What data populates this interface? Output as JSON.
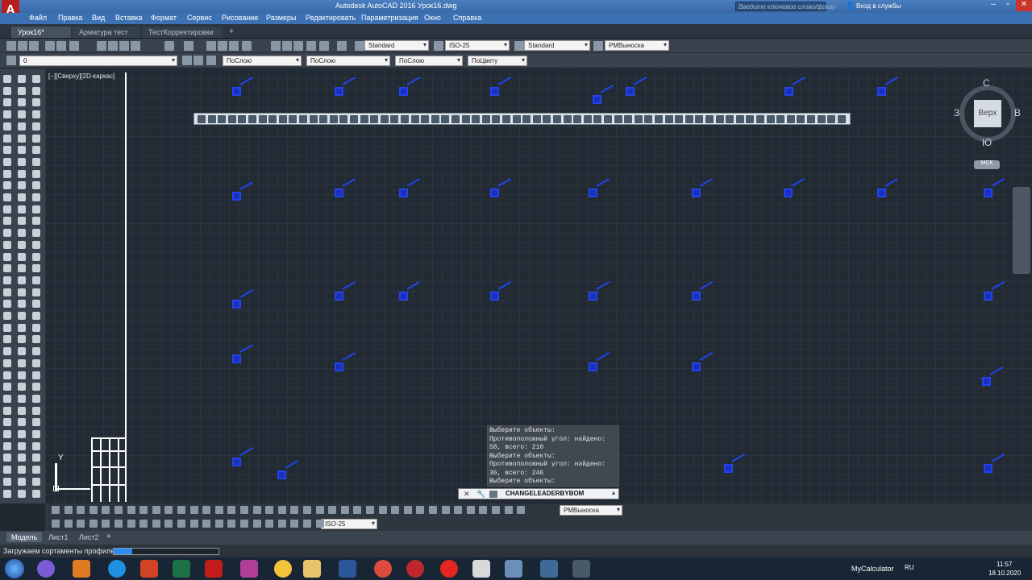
{
  "window": {
    "title": "Autodesk AutoCAD 2016   Урок16.dwg",
    "search_placeholder": "Введите ключевое слово/фразу",
    "sign_in": "Вход в службы"
  },
  "menu": [
    "Файл",
    "Правка",
    "Вид",
    "Вставка",
    "Формат",
    "Сервис",
    "Рисование",
    "Размеры",
    "Редактировать",
    "Параметризация",
    "Окно",
    "Справка"
  ],
  "tabs": [
    "Урок16*",
    "Арматура тест",
    "ТестКорректировки"
  ],
  "toolbar1": {
    "text_style": "Standard",
    "dim_style": "ISO-25",
    "table_style": "Standard",
    "mleader_style": "РМВыноска"
  },
  "toolbar2": {
    "layer": "0",
    "color": "ПоСлою",
    "linetype": "ПоСлою",
    "lineweight": "ПоСлою",
    "plotstyle": "ПоЦвету"
  },
  "viewport": {
    "label": "[−][Сверху][2D-каркас]"
  },
  "viewcube": {
    "north": "С",
    "south": "Ю",
    "west": "З",
    "east": "В",
    "face": "Верх",
    "ucs": "МСК"
  },
  "ucs_axis": {
    "y_label": "Y"
  },
  "command": {
    "history": [
      "Выберите объекты:",
      "Противоположный угол: найдено:",
      "58, всего: 210",
      "Выберите объекты:",
      "Противоположный угол: найдено:",
      "36, всего: 246",
      "Выберите объекты:"
    ],
    "current": "CHANGELEADERBYBOM"
  },
  "bottom_toolbar": {
    "mleader_style": "РМВыноска",
    "dim_style": "ISO-25"
  },
  "layout_tabs": [
    "Модель",
    "Лист1",
    "Лист2"
  ],
  "status": {
    "message": "Загружаем сортаменты профилей..."
  },
  "taskbar": {
    "app": "MyCalculator",
    "lang": "RU",
    "time": "11:57",
    "date": "18.10.2020"
  },
  "colors": {
    "accent": "#2244ee",
    "menubar": "#3c72b4",
    "canvas": "#222a33"
  }
}
